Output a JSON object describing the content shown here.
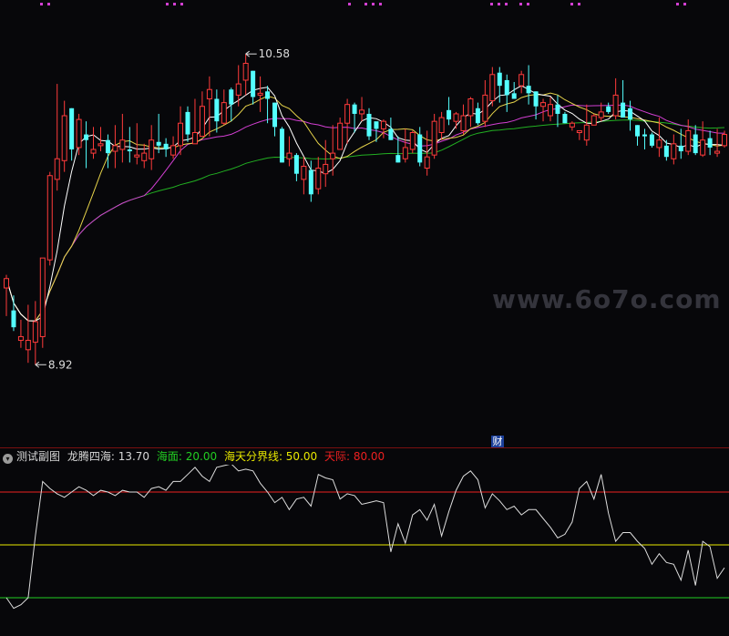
{
  "watermark": "www.6o7o.com",
  "badge": "财",
  "indicator": {
    "title": "测试副图",
    "main_label": "龙腾四海: 13.70",
    "sea_label": "海面: 20.00",
    "divider_label": "海天分界线: 50.00",
    "sky_label": "天际: 80.00",
    "colors": {
      "main": "#dddddd",
      "sea": "#22cc22",
      "divider": "#e8e800",
      "sky": "#ee2020"
    }
  },
  "chart_data": [
    {
      "type": "candlestick",
      "ylim": [
        8.6,
        10.8
      ],
      "annotations": {
        "high": "10.58",
        "low": "8.92"
      },
      "colors": {
        "up": "#ff3b3b",
        "down": "#54ffff",
        "ma5": "#ffffff",
        "ma10": "#e6d34a",
        "ma20": "#d23fd2",
        "ma60": "#22b022"
      },
      "candles": [
        [
          9.33,
          9.38,
          9.18,
          9.4
        ],
        [
          9.21,
          9.12,
          9.1,
          9.29
        ],
        [
          9.05,
          9.07,
          9.01,
          9.16
        ],
        [
          9.0,
          9.05,
          8.93,
          9.24
        ],
        [
          9.04,
          9.15,
          8.92,
          9.26
        ],
        [
          9.07,
          9.49,
          9.01,
          9.49
        ],
        [
          9.48,
          9.93,
          9.45,
          9.95
        ],
        [
          9.91,
          10.02,
          9.85,
          10.42
        ],
        [
          10.01,
          10.25,
          9.95,
          10.33
        ],
        [
          10.29,
          10.07,
          10.01,
          10.29
        ],
        [
          10.08,
          10.23,
          10.04,
          10.26
        ],
        [
          10.15,
          10.12,
          9.97,
          10.22
        ],
        [
          10.05,
          10.07,
          10.02,
          10.19
        ],
        [
          10.09,
          10.1,
          10.06,
          10.19
        ],
        [
          10.12,
          10.05,
          9.97,
          10.15
        ],
        [
          10.06,
          10.09,
          9.97,
          10.2
        ],
        [
          10.07,
          10.12,
          10.0,
          10.26
        ],
        [
          10.07,
          10.06,
          10.0,
          10.19
        ],
        [
          10.03,
          10.04,
          9.99,
          10.21
        ],
        [
          10.01,
          10.05,
          9.97,
          10.1
        ],
        [
          10.02,
          10.12,
          9.96,
          10.2
        ],
        [
          10.11,
          10.09,
          10.05,
          10.26
        ],
        [
          10.1,
          10.07,
          10.03,
          10.13
        ],
        [
          10.04,
          10.09,
          10.02,
          10.14
        ],
        [
          10.09,
          10.21,
          10.04,
          10.3
        ],
        [
          10.27,
          10.15,
          10.11,
          10.3
        ],
        [
          10.1,
          10.16,
          10.1,
          10.34
        ],
        [
          10.14,
          10.3,
          10.14,
          10.38
        ],
        [
          10.34,
          10.39,
          10.14,
          10.46
        ],
        [
          10.34,
          10.22,
          10.16,
          10.39
        ],
        [
          10.21,
          10.32,
          10.2,
          10.39
        ],
        [
          10.39,
          10.31,
          10.22,
          10.4
        ],
        [
          10.36,
          10.42,
          10.3,
          10.52
        ],
        [
          10.44,
          10.53,
          10.36,
          10.58
        ],
        [
          10.49,
          10.35,
          10.31,
          10.49
        ],
        [
          10.36,
          10.37,
          10.27,
          10.46
        ],
        [
          10.38,
          10.34,
          10.21,
          10.41
        ],
        [
          10.32,
          10.19,
          10.14,
          10.32
        ],
        [
          10.18,
          10.0,
          10.0,
          10.19
        ],
        [
          10.02,
          10.05,
          9.98,
          10.14
        ],
        [
          10.04,
          9.94,
          9.9,
          10.05
        ],
        [
          9.91,
          9.98,
          9.83,
          10.03
        ],
        [
          9.96,
          9.83,
          9.79,
          10.01
        ],
        [
          9.86,
          9.97,
          9.83,
          10.03
        ],
        [
          9.94,
          9.99,
          9.87,
          10.12
        ],
        [
          10.02,
          10.05,
          9.93,
          10.2
        ],
        [
          10.07,
          10.21,
          10.07,
          10.24
        ],
        [
          10.21,
          10.31,
          10.1,
          10.34
        ],
        [
          10.31,
          10.26,
          10.16,
          10.32
        ],
        [
          10.26,
          10.28,
          10.22,
          10.35
        ],
        [
          10.26,
          10.14,
          10.12,
          10.29
        ],
        [
          10.22,
          10.18,
          10.11,
          10.21
        ],
        [
          10.18,
          10.22,
          10.13,
          10.23
        ],
        [
          10.18,
          10.12,
          10.12,
          10.24
        ],
        [
          10.04,
          10.0,
          10.0,
          10.14
        ],
        [
          10.02,
          10.08,
          10.0,
          10.18
        ],
        [
          10.07,
          10.16,
          10.05,
          10.17
        ],
        [
          10.15,
          10.0,
          9.98,
          10.19
        ],
        [
          9.97,
          10.03,
          9.93,
          10.17
        ],
        [
          10.04,
          10.22,
          10.02,
          10.26
        ],
        [
          10.16,
          10.24,
          10.12,
          10.27
        ],
        [
          10.28,
          10.23,
          10.2,
          10.35
        ],
        [
          10.22,
          10.26,
          10.18,
          10.27
        ],
        [
          10.17,
          10.25,
          10.15,
          10.31
        ],
        [
          10.25,
          10.34,
          10.19,
          10.35
        ],
        [
          10.29,
          10.21,
          10.2,
          10.32
        ],
        [
          10.22,
          10.36,
          10.19,
          10.44
        ],
        [
          10.33,
          10.47,
          10.3,
          10.51
        ],
        [
          10.48,
          10.41,
          10.32,
          10.51
        ],
        [
          10.44,
          10.36,
          10.27,
          10.47
        ],
        [
          10.37,
          10.34,
          10.34,
          10.43
        ],
        [
          10.41,
          10.47,
          10.37,
          10.49
        ],
        [
          10.41,
          10.37,
          10.31,
          10.52
        ],
        [
          10.38,
          10.3,
          10.23,
          10.38
        ],
        [
          10.3,
          10.32,
          10.22,
          10.34
        ],
        [
          10.25,
          10.31,
          10.22,
          10.35
        ],
        [
          10.31,
          10.26,
          10.19,
          10.36
        ],
        [
          10.26,
          10.21,
          10.21,
          10.27
        ],
        [
          10.19,
          10.21,
          10.17,
          10.22
        ],
        [
          10.16,
          10.17,
          10.12,
          10.17
        ],
        [
          10.12,
          10.2,
          10.09,
          10.31
        ],
        [
          10.2,
          10.25,
          10.2,
          10.26
        ],
        [
          10.24,
          10.27,
          10.22,
          10.32
        ],
        [
          10.3,
          10.27,
          10.26,
          10.32
        ],
        [
          10.25,
          10.36,
          10.23,
          10.45
        ],
        [
          10.32,
          10.24,
          10.24,
          10.44
        ],
        [
          10.29,
          10.23,
          10.17,
          10.33
        ],
        [
          10.2,
          10.14,
          10.09,
          10.2
        ],
        [
          10.15,
          10.14,
          10.07,
          10.18
        ],
        [
          10.15,
          10.09,
          10.08,
          10.16
        ],
        [
          10.08,
          10.12,
          10.03,
          10.24
        ],
        [
          10.09,
          10.03,
          10.01,
          10.12
        ],
        [
          10.02,
          10.1,
          9.99,
          10.15
        ],
        [
          10.09,
          10.06,
          10.02,
          10.18
        ],
        [
          10.06,
          10.17,
          10.04,
          10.23
        ],
        [
          10.15,
          10.05,
          10.04,
          10.2
        ],
        [
          10.04,
          10.12,
          10.03,
          10.22
        ],
        [
          10.13,
          10.08,
          10.04,
          10.17
        ],
        [
          10.05,
          10.06,
          10.03,
          10.18
        ],
        [
          10.09,
          10.15,
          10.08,
          10.17
        ]
      ]
    },
    {
      "type": "line",
      "ylim": [
        0,
        100
      ],
      "series": [
        {
          "name": "龙腾四海",
          "values": [
            20,
            14,
            16,
            20,
            55,
            86,
            82,
            79,
            77,
            80,
            83,
            81,
            78,
            81,
            80,
            78,
            81,
            80,
            80,
            77,
            82,
            83,
            81,
            86,
            86,
            90,
            94,
            89,
            86,
            94,
            95,
            96,
            92,
            93,
            92,
            85,
            80,
            74,
            77,
            70,
            76,
            77,
            72,
            90,
            88,
            87,
            76,
            79,
            78,
            73,
            74,
            75,
            74,
            46,
            62,
            51,
            67,
            70,
            64,
            73,
            55,
            69,
            81,
            89,
            92,
            87,
            71,
            79,
            75,
            70,
            72,
            67,
            70,
            70,
            65,
            60,
            54,
            56,
            63,
            82,
            86,
            76,
            90,
            68,
            52,
            57,
            57,
            52,
            48,
            39,
            45,
            40,
            39,
            30,
            47,
            27,
            52,
            49,
            31,
            37
          ],
          "color": "#dddddd"
        },
        {
          "name": "海面",
          "values": [
            20
          ],
          "color": "#22cc22"
        },
        {
          "name": "海天分界线",
          "values": [
            50
          ],
          "color": "#e8e800"
        },
        {
          "name": "天际",
          "values": [
            80
          ],
          "color": "#ee2020"
        }
      ]
    }
  ]
}
